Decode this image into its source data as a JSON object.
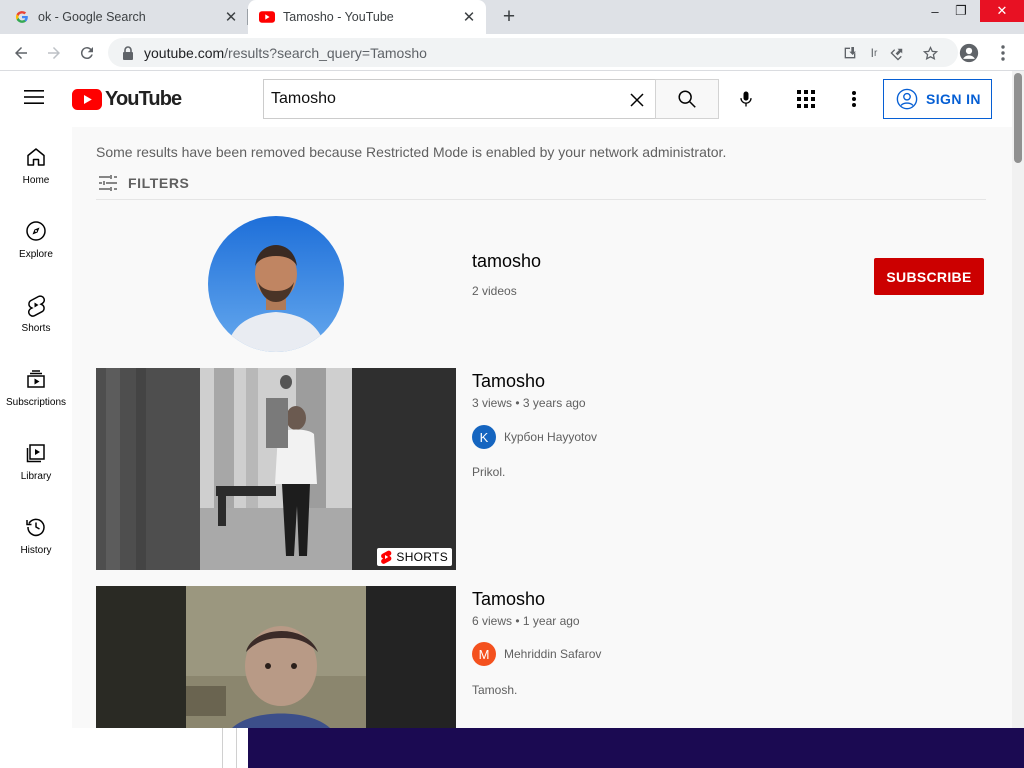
{
  "browser": {
    "tabs": [
      {
        "title": "ok - Google Search",
        "active": false
      },
      {
        "title": "Tamosho - YouTube",
        "active": true
      }
    ],
    "url_host": "youtube.com",
    "url_path": "/results?search_query=Tamosho",
    "window": {
      "minimize": "–",
      "restore": "❐",
      "close": "✕"
    }
  },
  "youtube": {
    "logo_text": "YouTube",
    "search_value": "Tamosho",
    "signin_label": "SIGN IN",
    "guide": [
      {
        "label": "Home",
        "icon": "home-icon"
      },
      {
        "label": "Explore",
        "icon": "explore-icon"
      },
      {
        "label": "Shorts",
        "icon": "shorts-icon"
      },
      {
        "label": "Subscriptions",
        "icon": "subscriptions-icon"
      },
      {
        "label": "Library",
        "icon": "library-icon"
      },
      {
        "label": "History",
        "icon": "history-icon"
      }
    ],
    "notice": "Some results have been removed because Restricted Mode is enabled by your network administrator.",
    "filters_label": "FILTERS",
    "channel": {
      "name": "tamosho",
      "videos": "2 videos",
      "subscribe_label": "SUBSCRIBE"
    },
    "videos": [
      {
        "title": "Tamosho",
        "meta": "3 views • 3 years ago",
        "channel_initial": "K",
        "channel_color": "#1565c0",
        "channel_name": "Курбон Hayyotov",
        "description": "Prikol.",
        "badge": "SHORTS"
      },
      {
        "title": "Tamosho",
        "meta": "6 views • 1 year ago",
        "channel_initial": "M",
        "channel_color": "#f4511e",
        "channel_name": "Mehriddin Safarov",
        "description": "Tamosh."
      }
    ]
  }
}
